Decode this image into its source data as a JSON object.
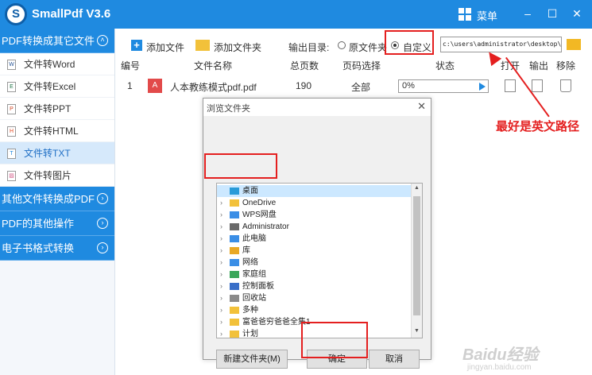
{
  "app": {
    "title": "SmallPdf V3.6",
    "menu_label": "菜单",
    "win_min": "–",
    "win_max": "☐",
    "win_close": "✕"
  },
  "sidebar": {
    "section1": "PDF转换成其它文件",
    "items": [
      "文件转Word",
      "文件转Excel",
      "文件转PPT",
      "文件转HTML",
      "文件转TXT",
      "文件转图片"
    ],
    "active_index": 4,
    "section2": "其他文件转换成PDF",
    "section3": "PDF的其他操作",
    "section4": "电子书格式转换"
  },
  "toolbar": {
    "add_file": "添加文件",
    "add_folder": "添加文件夹",
    "output_label": "输出目录:",
    "option_source": "原文件夹",
    "option_custom": "自定义",
    "selected": "custom",
    "path": "c:\\users\\administrator\\desktop\\"
  },
  "table": {
    "headers": [
      "编号",
      "文件名称",
      "总页数",
      "页码选择",
      "状态",
      "打开",
      "输出",
      "移除"
    ],
    "rows": [
      {
        "index": "1",
        "name": "人本教练模式pdf.pdf",
        "pages": "190",
        "page_select": "全部",
        "progress": "0%"
      }
    ]
  },
  "annotation": {
    "note": "最好是英文路径",
    "color": "#e41f1f"
  },
  "dialog": {
    "title": "浏览文件夹",
    "tree": [
      {
        "label": "桌面",
        "selected": true,
        "icon": "desktop-icon",
        "color": "#2a9bd8"
      },
      {
        "label": "OneDrive",
        "icon": "folder-icon",
        "color": "#f2c13a"
      },
      {
        "label": "WPS网盘",
        "icon": "cloud-icon",
        "color": "#3a8ee6"
      },
      {
        "label": "Administrator",
        "icon": "user-icon",
        "color": "#6a6a6a"
      },
      {
        "label": "此电脑",
        "icon": "computer-icon",
        "color": "#3a8ee6"
      },
      {
        "label": "库",
        "icon": "library-icon",
        "color": "#e8a825"
      },
      {
        "label": "网络",
        "icon": "network-icon",
        "color": "#3a8ee6"
      },
      {
        "label": "家庭组",
        "icon": "homegroup-icon",
        "color": "#3aa65a"
      },
      {
        "label": "控制面板",
        "icon": "control-panel-icon",
        "color": "#3a6fc8"
      },
      {
        "label": "回收站",
        "icon": "recycle-bin-icon",
        "color": "#8a8a8a"
      },
      {
        "label": "多种",
        "icon": "folder-icon",
        "color": "#f2c13a"
      },
      {
        "label": "富爸爸穷爸爸全集1",
        "icon": "folder-icon",
        "color": "#f2c13a"
      },
      {
        "label": "计划",
        "icon": "folder-icon",
        "color": "#f2c13a"
      }
    ],
    "new_folder": "新建文件夹(M)",
    "ok": "确定",
    "cancel": "取消"
  },
  "watermark": {
    "logo": "Baidu经验",
    "url": "jingyan.baidu.com"
  }
}
